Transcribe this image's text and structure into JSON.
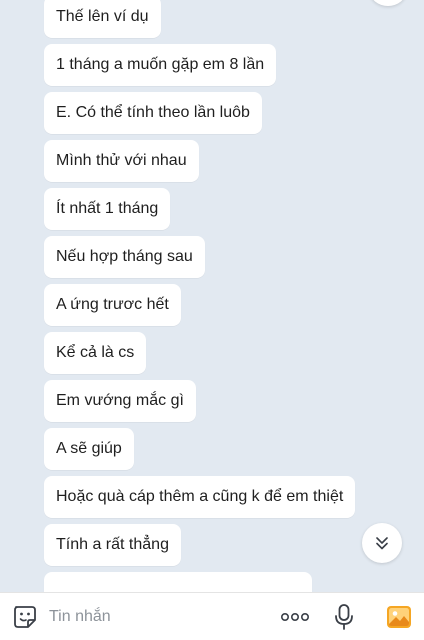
{
  "messages": [
    "Thế lên ví dụ",
    "1 tháng a muốn gặp em 8 lần",
    "E. Có thể tính theo lần luôb",
    "Mình thử với nhau",
    "Ít nhất 1 tháng",
    "Nếu hợp tháng sau",
    "A ứng trươc hết",
    "Kể cả là cs",
    "Em vướng mắc gì",
    "A sẽ giúp",
    "Hoặc quà cáp thêm a cũng k để em thiệt",
    "Tính a rất thẳng"
  ],
  "input": {
    "placeholder": "Tin nhắn"
  },
  "icons": {
    "emoji": "sticker-icon",
    "more": "more-icon",
    "mic": "microphone-icon",
    "gallery": "image-gallery-icon",
    "scroll": "chevron-double-down-icon"
  },
  "colors": {
    "background": "#e2e9f1",
    "bubble": "#ffffff",
    "gallery_accent": "#f5a623"
  }
}
